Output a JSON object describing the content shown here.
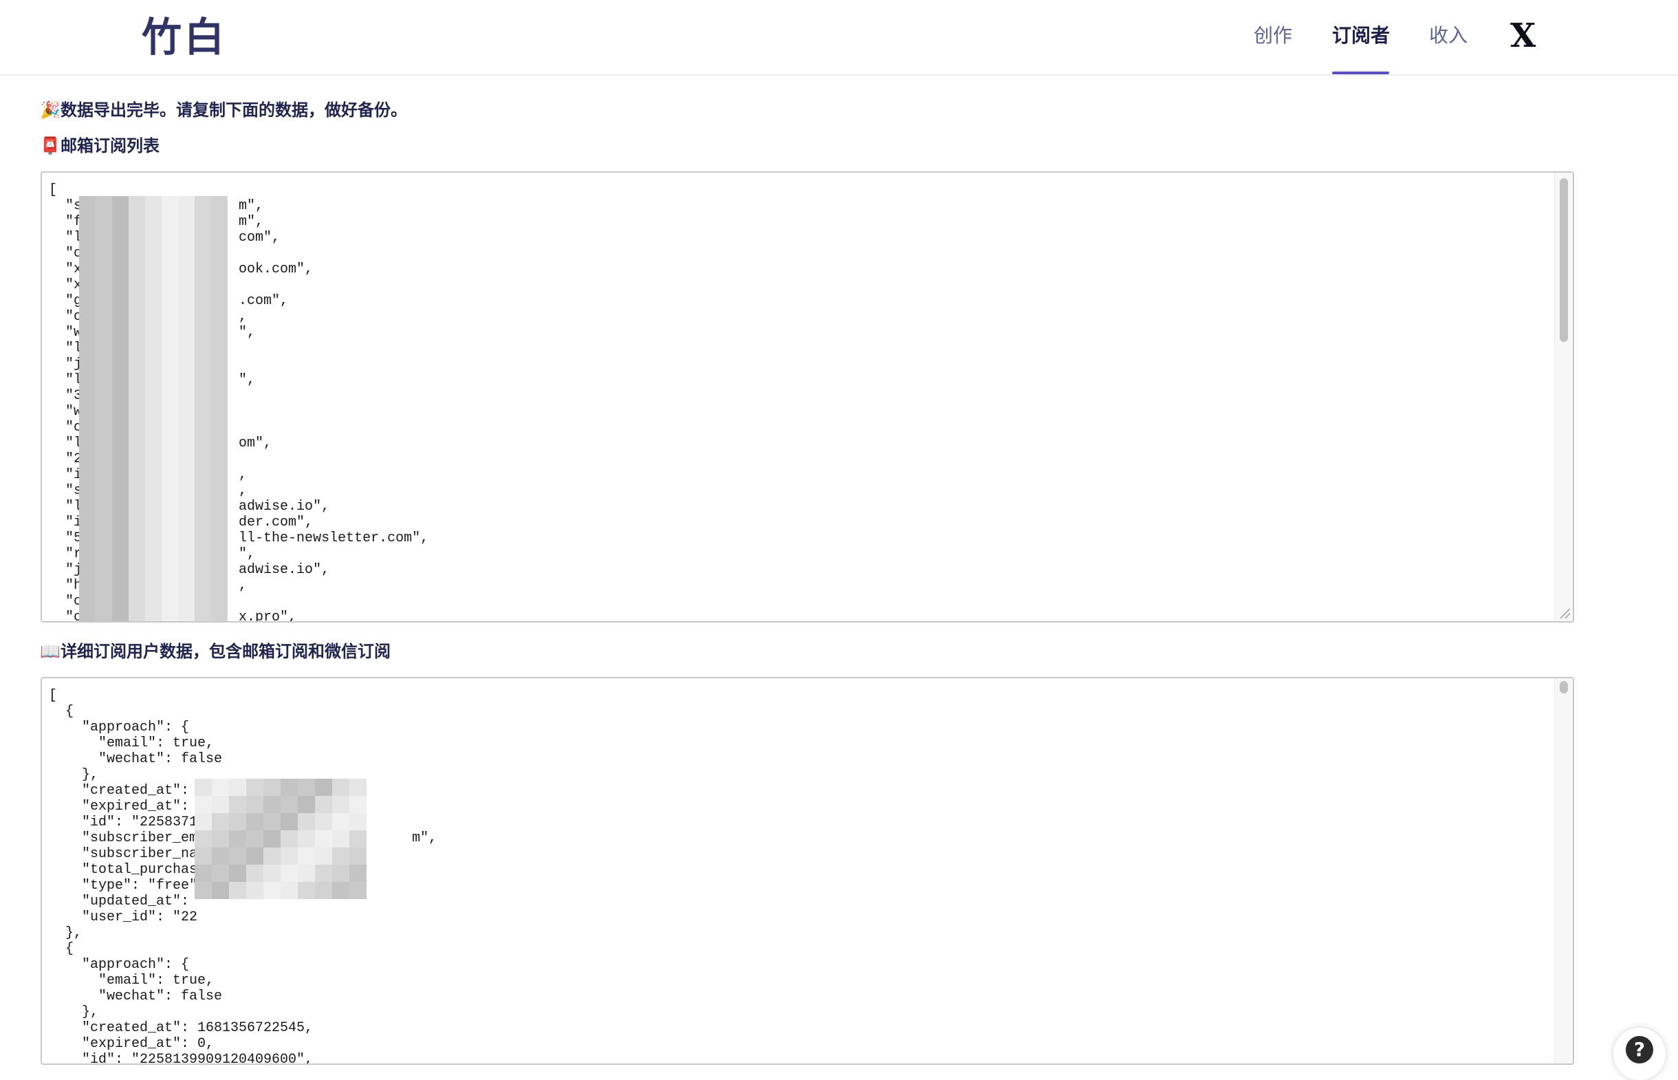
{
  "header": {
    "logo": "竹白",
    "nav": [
      {
        "label": "创作",
        "active": false
      },
      {
        "label": "订阅者",
        "active": true
      },
      {
        "label": "收入",
        "active": false
      }
    ],
    "x_logo": "X",
    "accent_color": "#5a4ec9"
  },
  "main": {
    "success_message": "数据导出完毕。请复制下面的数据，做好备份。",
    "success_emoji": "🎉",
    "email_list_title": "邮箱订阅列表",
    "email_list_emoji": "📮",
    "email_list_text": "[\n  \"s                   m\",\n  \"f                   m\",\n  \"l                   com\",\n  \"c\n  \"x                   ook.com\",\n  \"x\n  \"g                   .com\",\n  \"c                   ,\n  \"w                   \",\n  \"l\n  \"j\n  \"l                   \",\n  \"3\n  \"w\n  \"c\n  \"l                   om\",\n  \"2\n  \"i                   ,\n  \"s                   ,\n  \"l                   adwise.io\",\n  \"i                   der.com\",\n  \"5                   ll-the-newsletter.com\",\n  \"r                   \",\n  \"j                   adwise.io\",\n  \"h                   ,\n  \"c\n  \"c                   x.pro\",",
    "detail_title": "详细订阅用户数据，包含邮箱订阅和微信订阅",
    "detail_emoji": "📖",
    "detail_text": "[\n  {\n    \"approach\": {\n      \"email\": true,\n      \"wechat\": false\n    },\n    \"created_at\":\n    \"expired_at\":\n    \"id\": \"2258371\n    \"subscriber_em                          m\",\n    \"subscriber_na\n    \"total_purchas\n    \"type\": \"free\"\n    \"updated_at\":\n    \"user_id\": \"22\n  },\n  {\n    \"approach\": {\n      \"email\": true,\n      \"wechat\": false\n    },\n    \"created_at\": 1681356722545,\n    \"expired_at\": 0,\n    \"id\": \"2258139909120409600\","
  },
  "help": {
    "icon": "question-icon",
    "symbol": "?"
  }
}
